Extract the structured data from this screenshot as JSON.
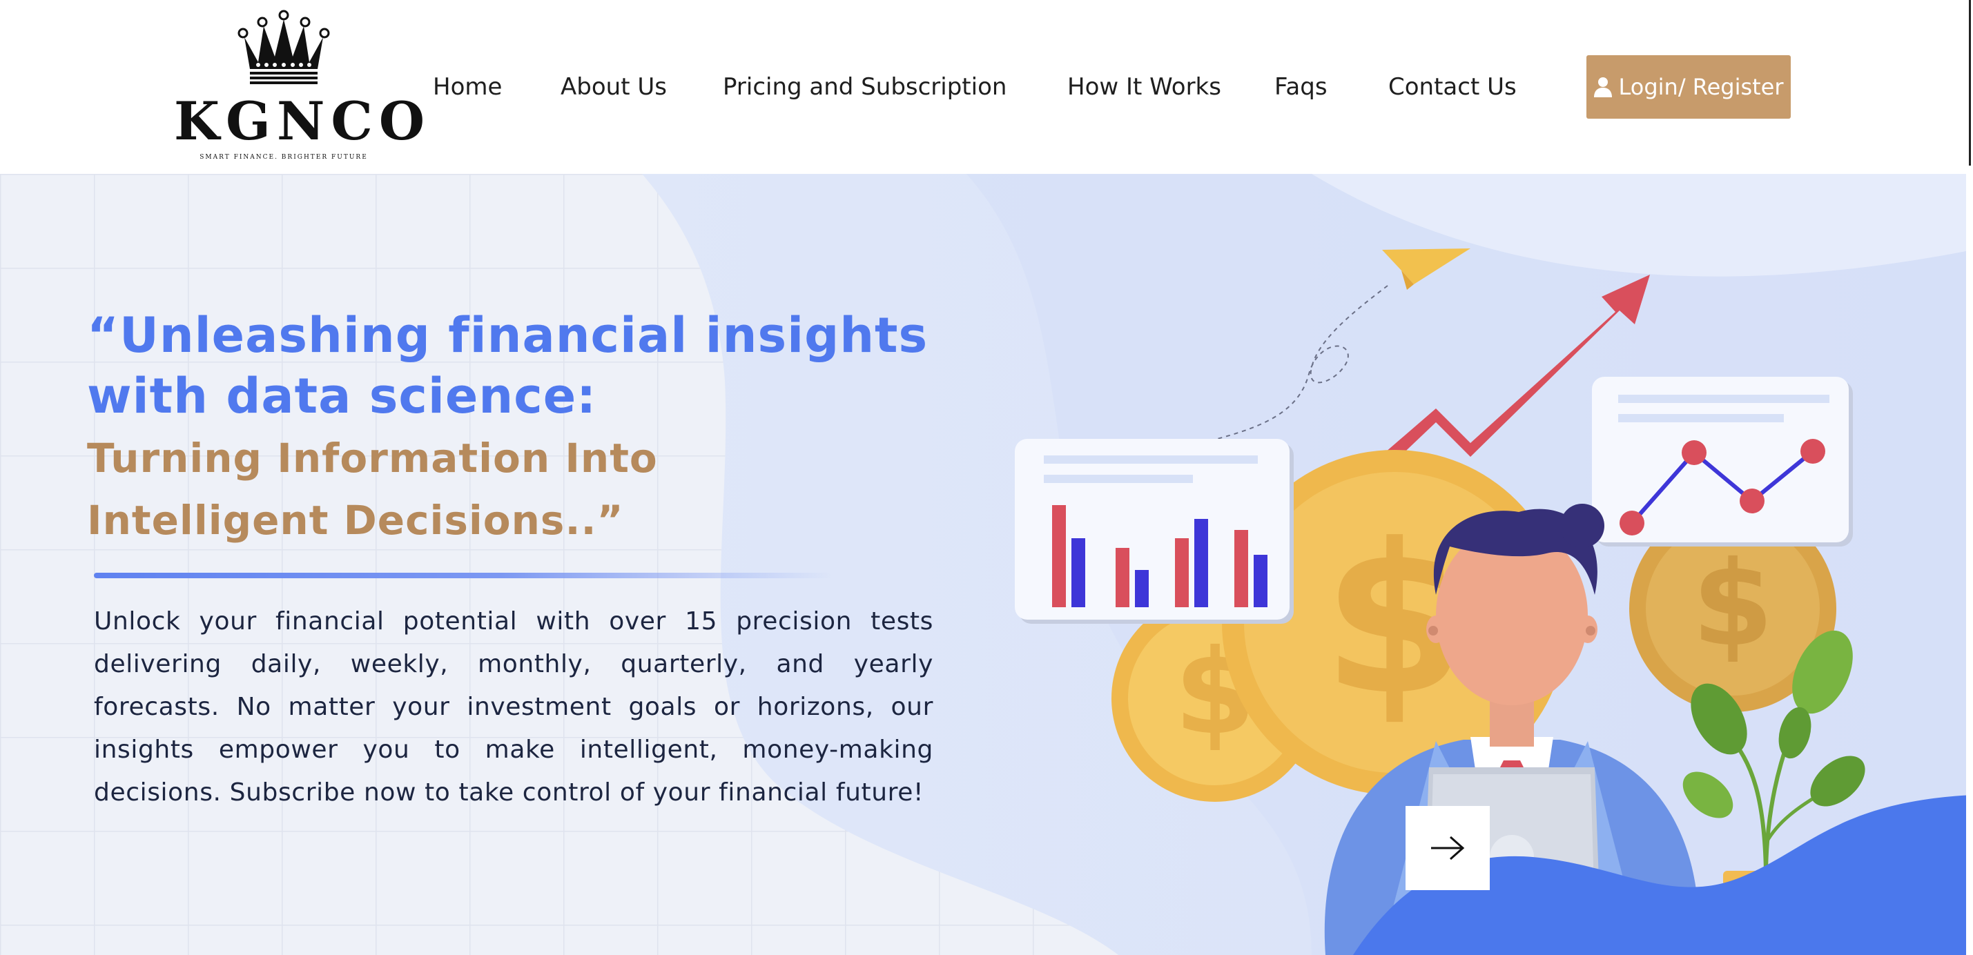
{
  "brand": {
    "logo_text": "KGNCO",
    "tagline": "SMART FINANCE. BRIGHTER FUTURE"
  },
  "nav": {
    "items": [
      {
        "label": "Home"
      },
      {
        "label": "About Us"
      },
      {
        "label": "Pricing and Subscription"
      },
      {
        "label": "How It Works"
      },
      {
        "label": "Faqs"
      },
      {
        "label": "Contact Us"
      }
    ],
    "login_label": "Login/ Register"
  },
  "hero": {
    "headline_line1": "“Unleashing financial insights",
    "headline_line2": "with data science:",
    "subheadline_line1": "Turning Information Into",
    "subheadline_line2": "Intelligent Decisions..”",
    "description": "Unlock your financial potential with over 15 precision tests delivering daily, weekly, monthly, quarterly, and yearly forecasts. No matter your investment goals or horizons, our insights empower you to make intelligent, money-making decisions. Subscribe now to take control of your financial future!"
  },
  "icons": {
    "crown": "crown-icon",
    "user": "user-icon",
    "arrow": "arrow-right-icon"
  },
  "colors": {
    "accent_blue": "#5079ee",
    "accent_gold": "#b68a5c",
    "button_bg": "#c79b6b",
    "hero_bg": "#eef1fa"
  }
}
